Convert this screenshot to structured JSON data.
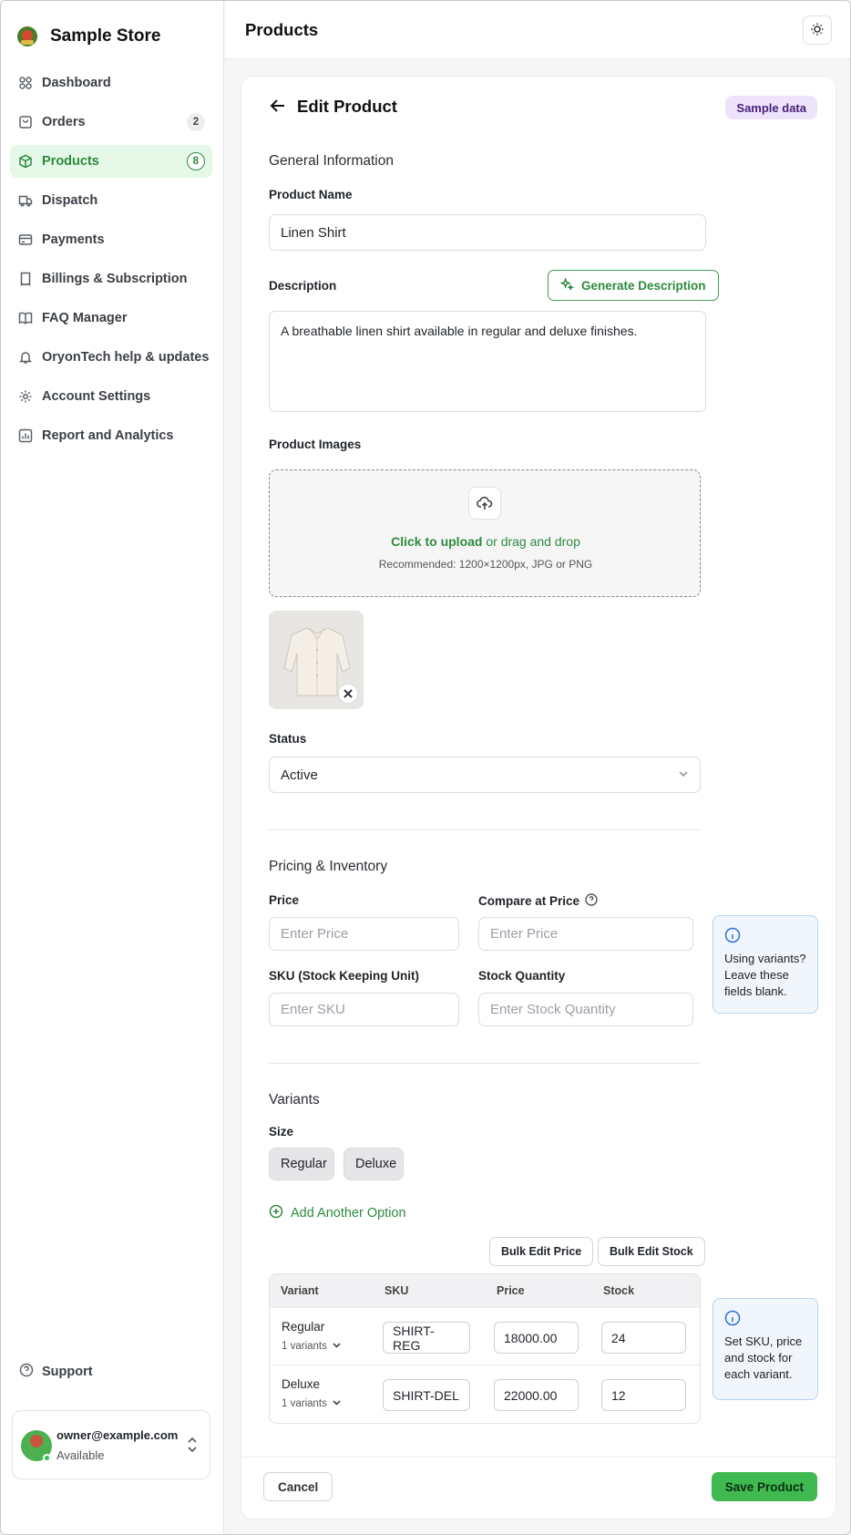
{
  "brand": {
    "name": "Sample Store"
  },
  "sidebar": {
    "items": [
      {
        "label": "Dashboard",
        "icon": "grid-icon",
        "badge": ""
      },
      {
        "label": "Orders",
        "icon": "bag-icon",
        "badge": "2"
      },
      {
        "label": "Products",
        "icon": "box-icon",
        "badge": "8",
        "active": true
      },
      {
        "label": "Dispatch",
        "icon": "truck-icon",
        "badge": ""
      },
      {
        "label": "Payments",
        "icon": "card-icon",
        "badge": ""
      },
      {
        "label": "Billings & Subscription",
        "icon": "receipt-icon",
        "badge": ""
      },
      {
        "label": "FAQ Manager",
        "icon": "book-icon",
        "badge": ""
      },
      {
        "label": "OryonTech help & updates",
        "icon": "bell-icon",
        "badge": ""
      },
      {
        "label": "Account Settings",
        "icon": "gear-icon",
        "badge": ""
      },
      {
        "label": "Report and Analytics",
        "icon": "chart-icon",
        "badge": ""
      }
    ],
    "support_label": "Support",
    "user": {
      "email": "owner@example.com",
      "status": "Available"
    }
  },
  "header": {
    "title": "Products"
  },
  "form": {
    "title": "Edit Product",
    "badge": "Sample data",
    "general": {
      "section_title": "General Information",
      "name_label": "Product Name",
      "name_value": "Linen Shirt",
      "description_label": "Description",
      "generate_label": "Generate Description",
      "description_value": "A breathable linen shirt available in regular and deluxe finishes.",
      "images_label": "Product Images",
      "upload_action": "Click to upload",
      "upload_rest": " or drag and drop",
      "upload_hint": "Recommended: 1200×1200px, JPG or PNG",
      "status_label": "Status",
      "status_value": "Active"
    },
    "pricing": {
      "section_title": "Pricing & Inventory",
      "price_label": "Price",
      "price_placeholder": "Enter Price",
      "compare_label": "Compare at Price",
      "compare_placeholder": "Enter Price",
      "sku_label": "SKU (Stock Keeping Unit)",
      "sku_placeholder": "Enter SKU",
      "stock_label": "Stock Quantity",
      "stock_placeholder": "Enter Stock Quantity",
      "info": "Using variants? Leave these fields blank."
    },
    "variants": {
      "section_title": "Variants",
      "option_label": "Size",
      "chips": [
        "Regular",
        "Deluxe"
      ],
      "add_option": "Add Another Option",
      "bulk_price": "Bulk Edit Price",
      "bulk_stock": "Bulk Edit Stock",
      "columns": [
        "Variant",
        "SKU",
        "Price",
        "Stock"
      ],
      "rows": [
        {
          "name": "Regular",
          "sub": "1 variants",
          "sku": "SHIRT-REG",
          "price": "18000.00",
          "stock": "24"
        },
        {
          "name": "Deluxe",
          "sub": "1 variants",
          "sku": "SHIRT-DEL",
          "price": "22000.00",
          "stock": "12"
        }
      ],
      "info": "Set SKU, price and stock for each variant."
    },
    "footer": {
      "cancel": "Cancel",
      "save": "Save Product"
    }
  },
  "colors": {
    "accent": "#2d8a3e",
    "save": "#3fb950",
    "active_nav_bg": "#e5f7e7",
    "badge_bg": "#ede4fb",
    "info_border": "#b9d4f3"
  }
}
